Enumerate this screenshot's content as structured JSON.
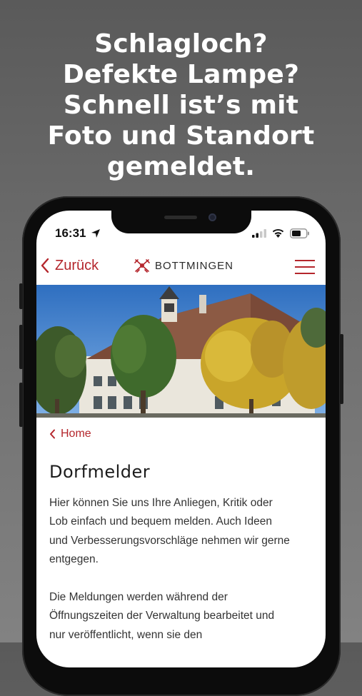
{
  "headline": {
    "lines": [
      "Schlagloch?",
      "Defekte Lampe?",
      "Schnell ist’s mit",
      "Foto und Standort",
      "gemeldet."
    ]
  },
  "status_bar": {
    "time": "16:31"
  },
  "nav": {
    "back_label": "Zurück",
    "brand": "BOTTMINGEN"
  },
  "breadcrumb": {
    "home_label": "Home"
  },
  "page": {
    "title": "Dorfmelder",
    "paragraph1": [
      "Hier können Sie uns Ihre Anliegen, Kritik oder",
      "Lob einfach und bequem melden. Auch Ideen",
      "und Verbesserungsvorschläge nehmen wir gerne",
      "entgegen."
    ],
    "paragraph2": [
      "Die Meldungen werden während der",
      "Öffnungszeiten der Verwaltung bearbeitet und",
      "nur veröffentlicht, wenn sie den"
    ]
  },
  "colors": {
    "accent": "#b4262c",
    "background": "#6e6e6e"
  },
  "icons": [
    "location-arrow-icon",
    "signal-icon",
    "wifi-icon",
    "battery-icon",
    "chevron-left-icon",
    "crest-icon",
    "hamburger-menu-icon"
  ]
}
